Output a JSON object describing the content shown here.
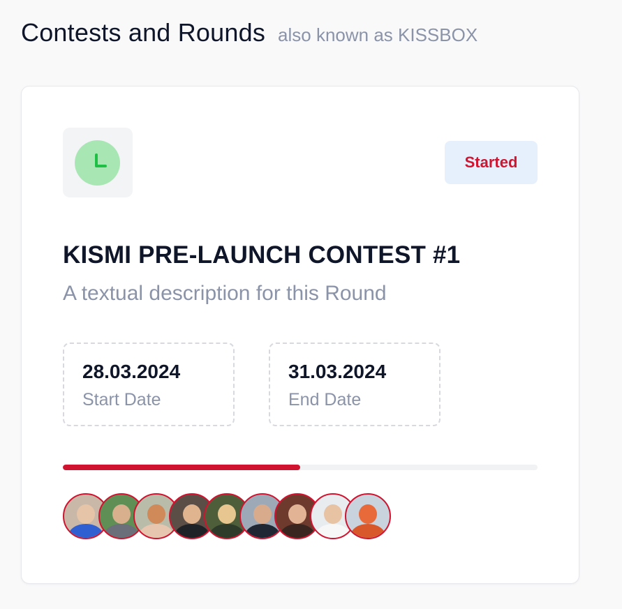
{
  "header": {
    "title": "Contests and Rounds",
    "subtitle": "also known as KISSBOX"
  },
  "card": {
    "icon": "clock-icon",
    "status": "Started",
    "title": "KISMI PRE-LAUNCH CONTEST #1",
    "description": "A textual description for this Round",
    "start": {
      "value": "28.03.2024",
      "label": "Start Date"
    },
    "end": {
      "value": "31.03.2024",
      "label": "End Date"
    },
    "progress_percent": 50,
    "participants": [
      {
        "bg": "#c9b8a8",
        "head": "#e5c4a8",
        "body": "#2f5fd0"
      },
      {
        "bg": "#5f8f55",
        "head": "#d9b08e",
        "body": "#6b6f7a"
      },
      {
        "bg": "#b9bca8",
        "head": "#d08a5a",
        "body": "#e7c6b0"
      },
      {
        "bg": "#5a4e46",
        "head": "#e0b48f",
        "body": "#1f2328"
      },
      {
        "bg": "#4f5e3a",
        "head": "#e8c690",
        "body": "#2e3b2b"
      },
      {
        "bg": "#9ea9b8",
        "head": "#d8ab8c",
        "body": "#1e2733"
      },
      {
        "bg": "#6e3a2e",
        "head": "#e2b495",
        "body": "#3a2520"
      },
      {
        "bg": "#e9ecef",
        "head": "#e7c2a3",
        "body": "#f7f7f7"
      },
      {
        "bg": "#c8d3de",
        "head": "#e86a3a",
        "body": "#d9582b"
      }
    ]
  },
  "colors": {
    "accent": "#d01430",
    "badge_bg": "#e6f0fd",
    "clock_bg": "#a8e6b4",
    "clock_hands": "#1fbf45"
  }
}
